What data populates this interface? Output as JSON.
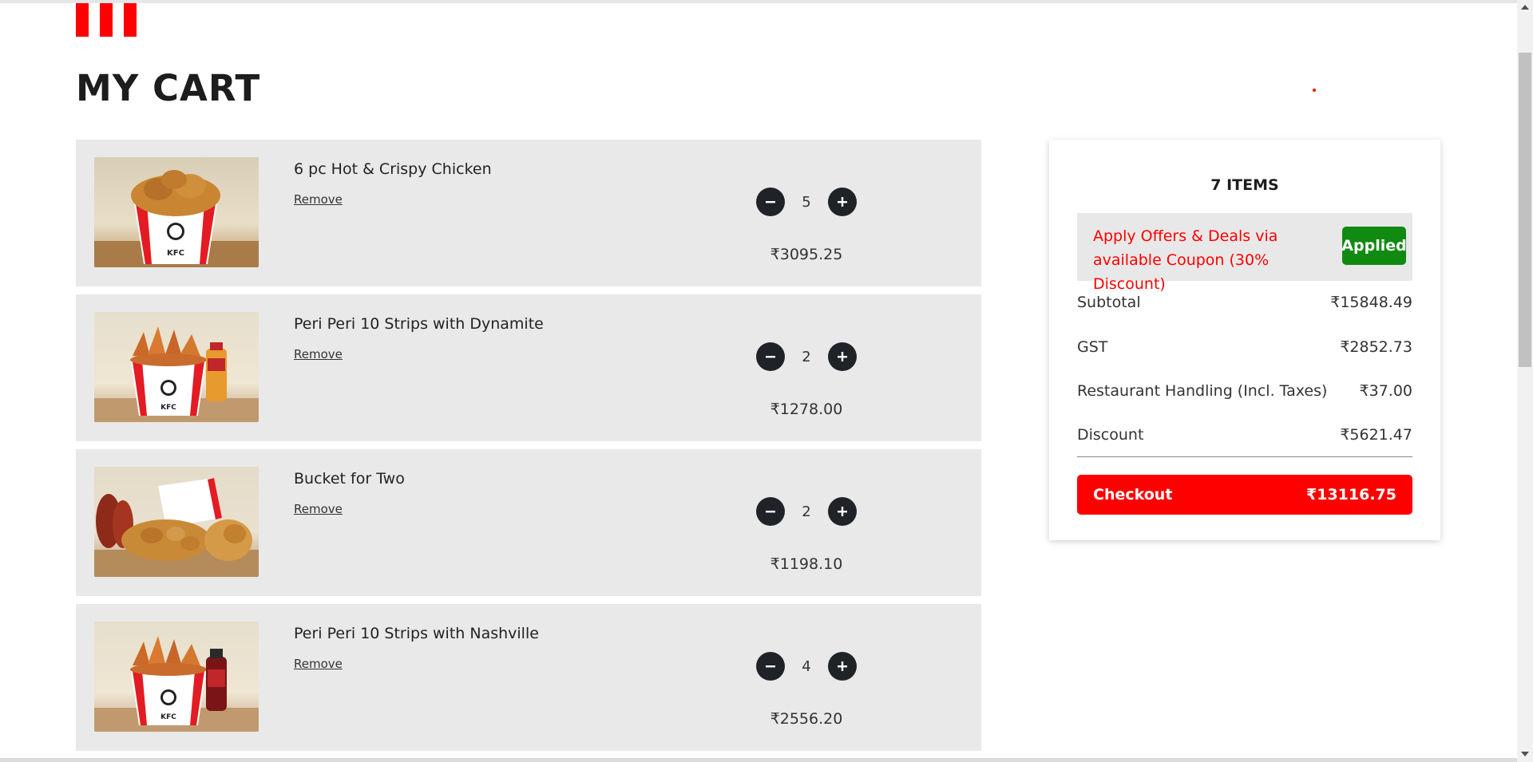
{
  "page": {
    "title": "MY CART"
  },
  "cart": {
    "items": [
      {
        "name": "6 pc Hot & Crispy Chicken",
        "remove_label": "Remove",
        "quantity": "5",
        "price": "₹3095.25",
        "image_icon": "chicken-bucket-image"
      },
      {
        "name": "Peri Peri 10 Strips with Dynamite",
        "remove_label": "Remove",
        "quantity": "2",
        "price": "₹1278.00",
        "image_icon": "strips-bucket-with-sauce-image"
      },
      {
        "name": "Bucket for Two",
        "remove_label": "Remove",
        "quantity": "2",
        "price": "₹1198.10",
        "image_icon": "bucket-for-two-image"
      },
      {
        "name": "Peri Peri 10 Strips with Nashville",
        "remove_label": "Remove",
        "quantity": "4",
        "price": "₹2556.20",
        "image_icon": "strips-bucket-with-bottle-image"
      }
    ]
  },
  "summary": {
    "items_count": "7 ITEMS",
    "offer_text": "Apply Offers & Deals via available Coupon (30% Discount)",
    "applied_label": "Applied",
    "rows": [
      {
        "label": "Subtotal",
        "value": "₹15848.49"
      },
      {
        "label": "GST",
        "value": "₹2852.73"
      },
      {
        "label": "Restaurant Handling (Incl. Taxes)",
        "value": "₹37.00"
      },
      {
        "label": "Discount",
        "value": "₹5621.47"
      }
    ],
    "checkout_label": "Checkout",
    "checkout_total": "₹13116.75"
  },
  "colors": {
    "brand_red": "#ff0000",
    "applied_green": "#118a11",
    "item_bg": "#e9e9e9",
    "qty_button": "#1f2328"
  }
}
